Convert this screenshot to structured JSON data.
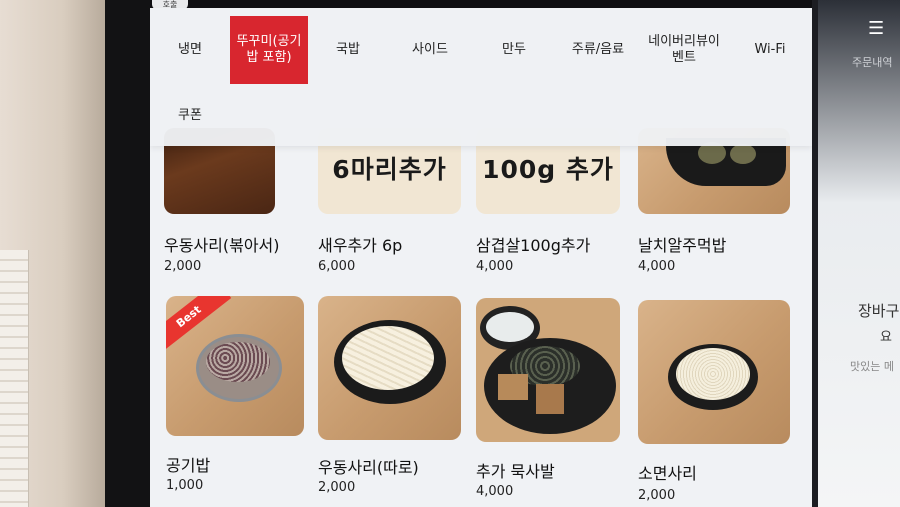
{
  "kiosk": {
    "top_tab_label": "호출",
    "categories": [
      {
        "label": "냉면"
      },
      {
        "label": "뚜꾸미(공기밥 포함)"
      },
      {
        "label": "국밥"
      },
      {
        "label": "사이드"
      },
      {
        "label": "만두"
      },
      {
        "label": "주류/음료"
      },
      {
        "label": "네이버리뷰이벤트"
      },
      {
        "label": "Wi-Fi"
      },
      {
        "label": "쿠폰"
      }
    ],
    "active_category": "뚜꾸미(공기밥 포함)",
    "promo_texts": [
      "6마리추가",
      "100g 추가"
    ],
    "items": [
      {
        "name": "우동사리(볶아서)",
        "price": "2,000"
      },
      {
        "name": "새우추가 6p",
        "price": "6,000"
      },
      {
        "name": "삼겹살100g추가",
        "price": "4,000"
      },
      {
        "name": "날치알주먹밥",
        "price": "4,000"
      },
      {
        "name": "공기밥",
        "price": "1,000",
        "badge": "Best"
      },
      {
        "name": "우동사리(따로)",
        "price": "2,000"
      },
      {
        "name": "추가 묵사발",
        "price": "4,000"
      },
      {
        "name": "소면사리",
        "price": "2,000"
      }
    ],
    "side_panel": {
      "order_text": "주문내역",
      "cart_title": "장바구",
      "cart_sub": "요",
      "note": "맛있는 메"
    },
    "colors": {
      "active_tab": "#d8262f",
      "badge": "#e8352f"
    }
  }
}
